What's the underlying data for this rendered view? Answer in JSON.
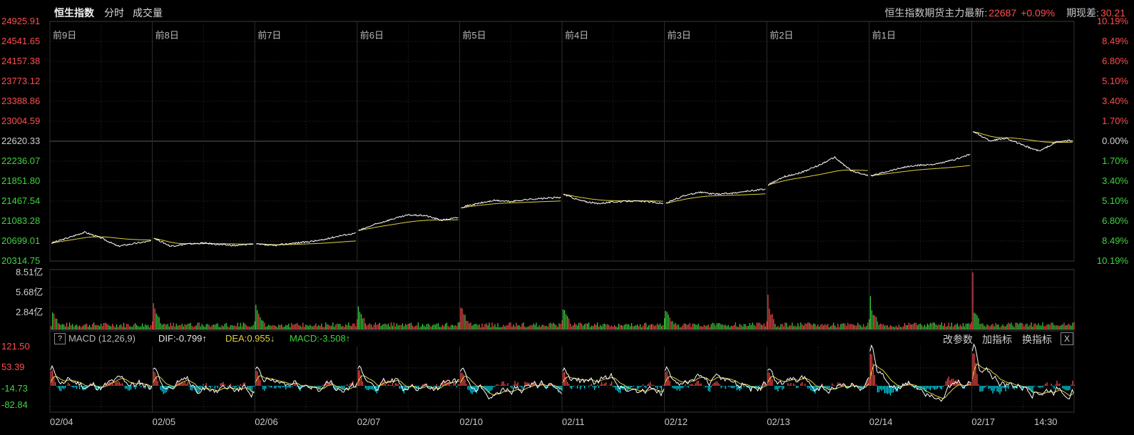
{
  "header": {
    "title": "恒生指数",
    "tab_minute": "分时",
    "tab_volume": "成交量",
    "futures_label": "恒生指数期货主力最新:",
    "futures_price": "22687",
    "futures_change": "+0.09%",
    "basis_label": "期现差:",
    "basis_value": "30.21"
  },
  "price_axis_left": [
    "24925.91",
    "24541.65",
    "24157.38",
    "23773.12",
    "23388.86",
    "23004.59",
    "22620.33",
    "22236.07",
    "21851.80",
    "21467.54",
    "21083.28",
    "20699.01",
    "20314.75"
  ],
  "price_axis_right": [
    "10.19%",
    "8.49%",
    "6.80%",
    "5.10%",
    "3.40%",
    "1.70%",
    "0.00%",
    "1.70%",
    "3.40%",
    "5.10%",
    "6.80%",
    "8.49%",
    "10.19%"
  ],
  "day_labels": [
    "前9日",
    "前8日",
    "前7日",
    "前6日",
    "前5日",
    "前4日",
    "前3日",
    "前2日",
    "前1日"
  ],
  "volume_axis": [
    "8.51亿",
    "5.68亿",
    "2.84亿"
  ],
  "macd": {
    "help": "?",
    "name": "MACD (12,26,9)",
    "dif": "DIF:-0.799↑",
    "dea": "DEA:0.955↓",
    "macd": "MACD:-3.508↑",
    "axis": [
      "121.50",
      "53.39",
      "-14.73",
      "-82.84"
    ],
    "btn_params": "改参数",
    "btn_add": "加指标",
    "btn_switch": "换指标",
    "btn_close": "X"
  },
  "x_labels": [
    "02/04",
    "02/05",
    "02/06",
    "02/07",
    "02/10",
    "02/11",
    "02/12",
    "02/13",
    "02/14",
    "02/17",
    "14:30"
  ],
  "colors": {
    "up": "#ff4d4d",
    "down": "#3dd63d",
    "line": "#ffffff",
    "avg": "#e0d040",
    "dif": "#ffffff",
    "dea": "#e0d040",
    "macd_neg": "#00e5ff"
  },
  "chart_data": {
    "type": "line",
    "title": "恒生指数",
    "ylim": [
      20314.75,
      24925.91
    ],
    "reference_close": 22620.33,
    "days": [
      "02/04",
      "02/05",
      "02/06",
      "02/07",
      "02/10",
      "02/11",
      "02/12",
      "02/13",
      "02/14",
      "02/17"
    ],
    "series": [
      {
        "name": "",
        "values": [
          [
            20660,
            20760,
            20870,
            20760,
            20600,
            20650,
            20700
          ],
          [
            20760,
            20600,
            20640,
            20660,
            20630,
            20610,
            20650
          ],
          [
            20640,
            20610,
            20650,
            20680,
            20720,
            20800,
            20850
          ],
          [
            20900,
            21020,
            21120,
            21200,
            21190,
            21100,
            21150
          ],
          [
            21350,
            21420,
            21480,
            21460,
            21500,
            21520,
            21540
          ],
          [
            21600,
            21480,
            21420,
            21450,
            21470,
            21460,
            21420
          ],
          [
            21430,
            21560,
            21640,
            21600,
            21620,
            21660,
            21700
          ],
          [
            21780,
            21940,
            22020,
            22150,
            22310,
            22050,
            21960
          ],
          [
            21950,
            22040,
            22120,
            22160,
            22180,
            22260,
            22370
          ],
          [
            22810,
            22630,
            22680,
            22540,
            22430,
            22600,
            22640
          ]
        ]
      }
    ]
  }
}
